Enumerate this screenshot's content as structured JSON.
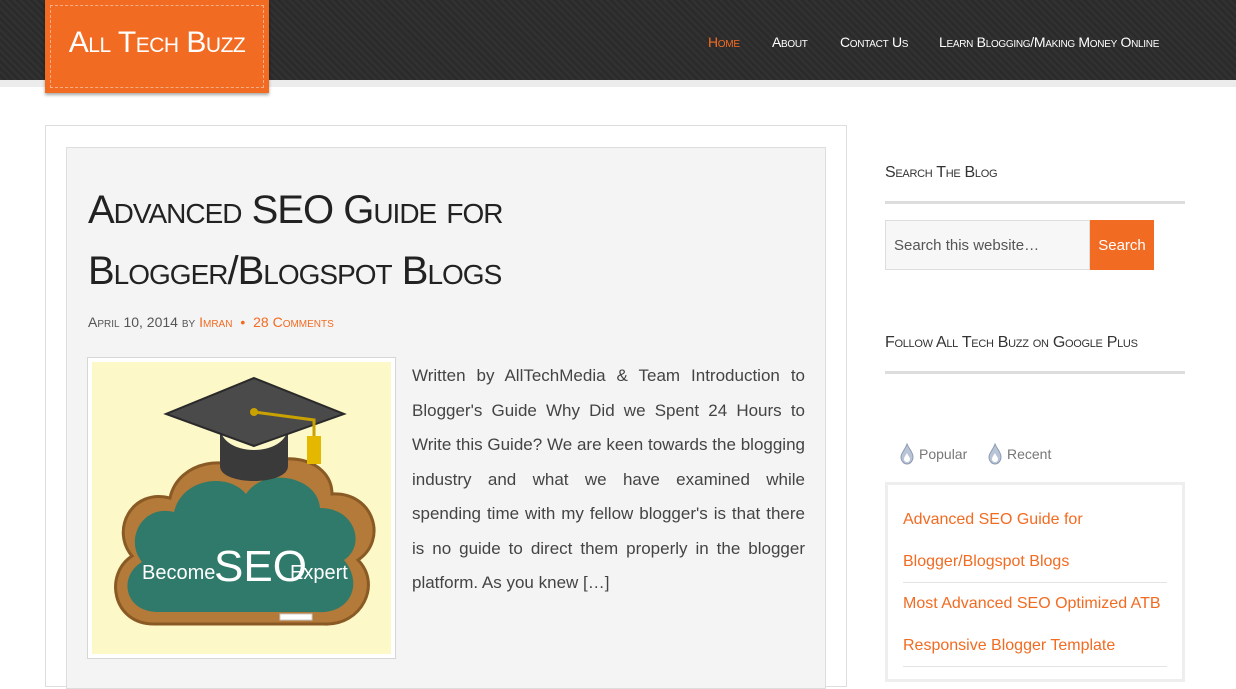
{
  "site": {
    "logo_text": "All Tech Buzz"
  },
  "nav": [
    {
      "label": "Home",
      "active": true
    },
    {
      "label": "About",
      "active": false
    },
    {
      "label": "Contact Us",
      "active": false
    },
    {
      "label": "Learn Blogging/Making Money Online",
      "active": false
    }
  ],
  "post": {
    "title": "Advanced SEO Guide for Blogger/Blogspot Blogs",
    "date": "April 10, 2014",
    "by": "by",
    "author": "Imran",
    "separator": "•",
    "comments": "28 Comments",
    "image_text": {
      "word1": "Become",
      "word2": "SEO",
      "word3": "Expert"
    },
    "excerpt": "Written by AllTechMedia & Team Introduction to Blogger's Guide Why Did we Spent 24 Hours to Write this Guide? We are keen towards the blogging industry and what we have examined while spending time with my fellow blogger's is that there is no guide to direct them properly in the blogger platform. As you knew […]"
  },
  "sidebar": {
    "search_title": "Search The Blog",
    "search_placeholder": "Search this website…",
    "search_button": "Search",
    "follow_title": "Follow All Tech Buzz on Google Plus",
    "tabs": [
      {
        "label": "Popular",
        "icon": "flame-icon"
      },
      {
        "label": "Recent",
        "icon": "flame-icon"
      }
    ],
    "posts": [
      {
        "title": "Advanced SEO Guide for Blogger/Blogspot Blogs"
      },
      {
        "title": "Most Advanced SEO Optimized ATB Responsive Blogger Template"
      }
    ]
  },
  "colors": {
    "accent": "#f26b22",
    "header_bg": "#2b2b2b",
    "post_bg": "#f4f4f4"
  }
}
